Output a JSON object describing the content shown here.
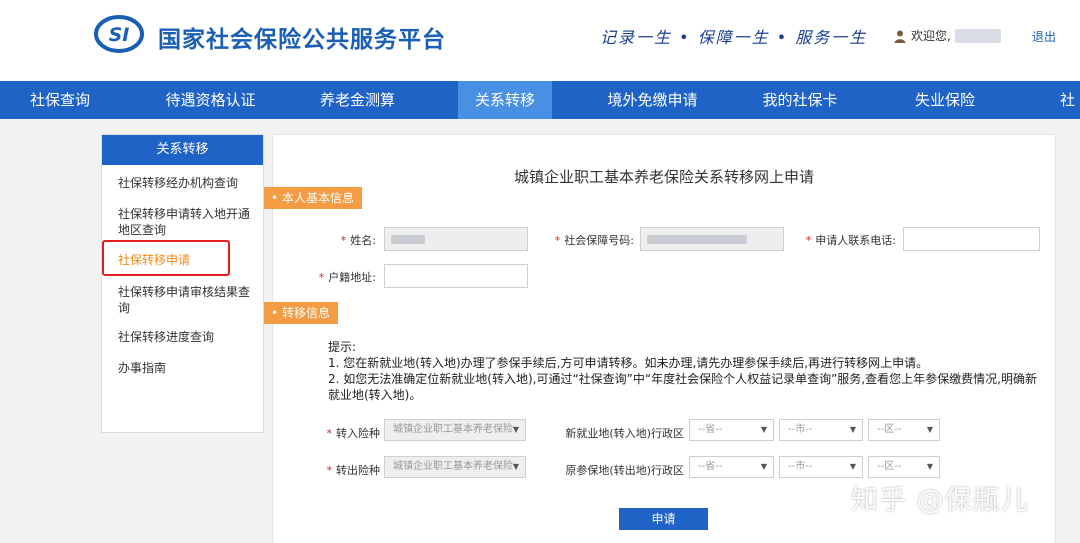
{
  "header": {
    "logo_text": "SI",
    "site_title": "国家社会保险公共服务平台",
    "slogan": "记录一生 • 保障一生 • 服务一生",
    "welcome": "欢迎您,",
    "logout": "退出"
  },
  "nav": [
    "社保查询",
    "待遇资格认证",
    "养老金测算",
    "关系转移",
    "境外免缴申请",
    "我的社保卡",
    "失业保险",
    "社"
  ],
  "nav_active": "关系转移",
  "sidebar": {
    "title": "关系转移",
    "items": [
      "社保转移经办机构查询",
      "社保转移申请转入地开通地区查询",
      "社保转移申请",
      "社保转移申请审核结果查询",
      "社保转移进度查询",
      "办事指南"
    ]
  },
  "form": {
    "title": "城镇企业职工基本养老保险关系转移网上申请",
    "section1": "本人基本信息",
    "section2": "转移信息",
    "required_mark": "*",
    "name_label": "姓名:",
    "ssn_label": "社会保障号码:",
    "phone_label": "申请人联系电话:",
    "address_label": "户籍地址:",
    "tips_title": "提示:",
    "tip1": "1. 您在新就业地(转入地)办理了参保手续后,方可申请转移。如未办理,请先办理参保手续后,再进行转移网上申请。",
    "tip2": "2. 如您无法准确定位新就业地(转入地),可通过“社保查询”中“年度社会保险个人权益记录单查询”服务,查看您上年参保缴费情况,明确新就业地(转入地)。",
    "in_type_label": "转入险种",
    "out_type_label": "转出险种",
    "insurance_type": "城镇企业职工基本养老保险",
    "new_area_label": "新就业地(转入地)行政区",
    "old_area_label": "原参保地(转出地)行政区",
    "province_placeholder": "--省--",
    "city_placeholder": "--市--",
    "district_placeholder": "--区--",
    "submit": "申请"
  },
  "watermark": "知乎 @保瓶儿",
  "colors": {
    "nav_blue": "#1f63c6",
    "nav_active": "#4a90e2",
    "accent_orange": "#f39c44",
    "highlight_red": "#e02020"
  }
}
